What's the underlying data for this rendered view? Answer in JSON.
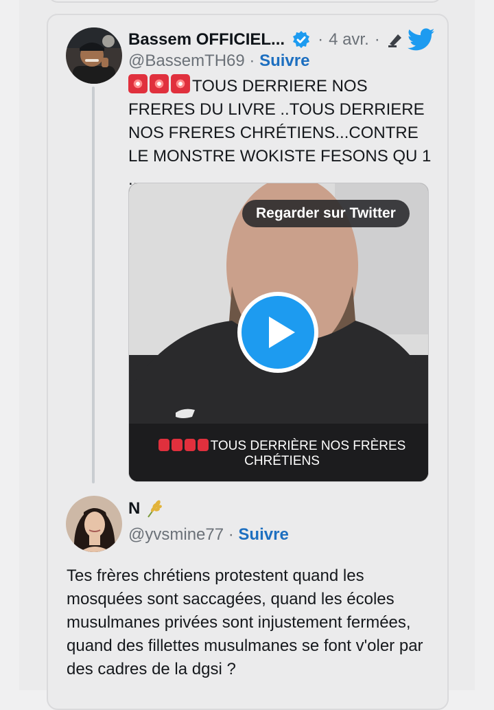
{
  "tweet": {
    "author_name": "Bassem OFFICIEL...",
    "date": "4 avr.",
    "handle": "@BassemTH69",
    "follow_label": "Suivre",
    "separator": "·",
    "text": "TOUS DERRIERE NOS FRERES DU LIVRE ..TOUS DERRIERE NOS FRERES CHRÉTIENS...CONTRE LE MONSTRE WOKISTE FESONS QU 1 ...",
    "video": {
      "watch_label": "Regarder sur Twitter",
      "caption": "TOUS DERRIÈRE NOS FRÈRES CHRÉTIENS"
    }
  },
  "reply": {
    "author_name": "N",
    "handle": "@yvsmine77",
    "follow_label": "Suivre",
    "separator": "·",
    "text": "Tes frères chrétiens protestent quand les mosquées sont saccagées, quand les écoles musulmanes privées sont injustement fermées, quand des fillettes musulmanes se font v'oler par des cadres de la dgsi ?"
  },
  "icons": {
    "verified": "verified-badge-icon",
    "caret": "caret-icon",
    "twitter": "twitter-bird-icon",
    "siren": "rotating-light-emoji",
    "wheat": "wheat-emoji"
  },
  "colors": {
    "twitter_blue": "#1d9bf0",
    "follow_blue": "#1d6fc0",
    "siren_red": "#e0303d"
  }
}
